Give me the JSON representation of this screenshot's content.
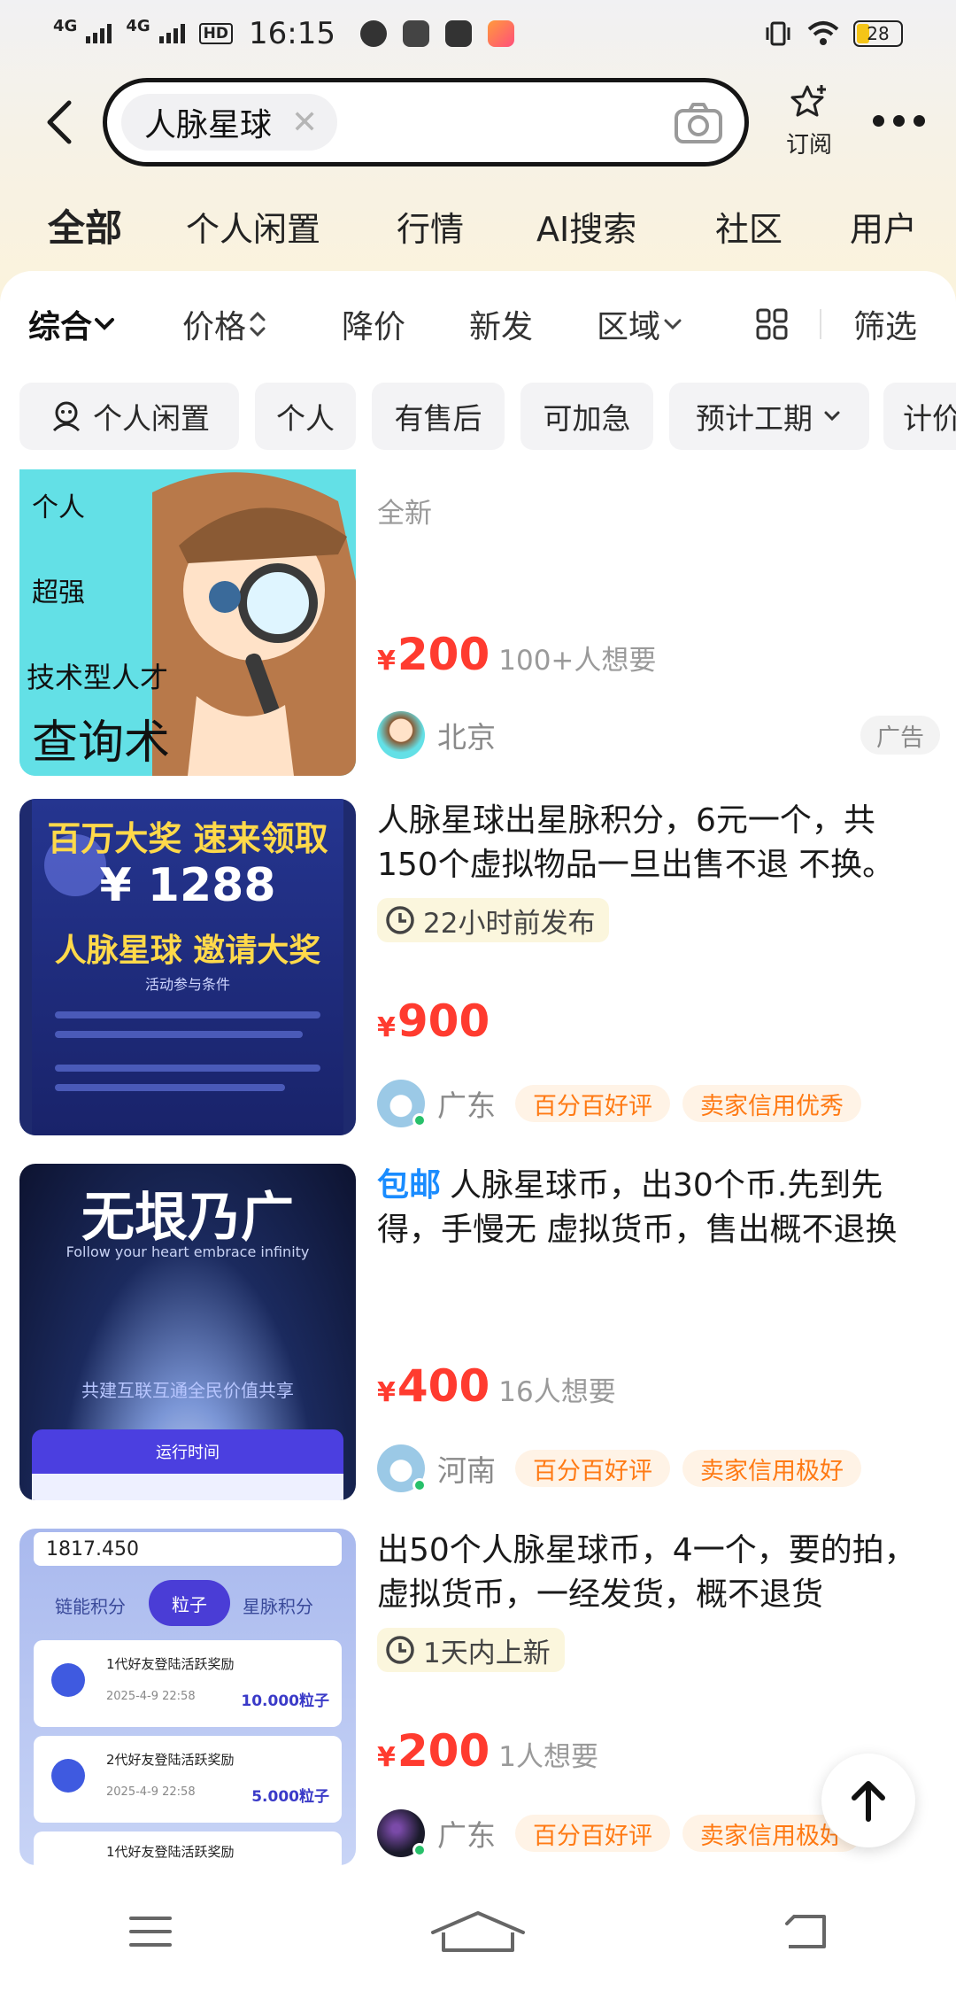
{
  "status_bar": {
    "network_1": "4G",
    "network_2": "4G",
    "hd": "HD",
    "time": "16:15",
    "battery": "28"
  },
  "search": {
    "query": "人脉星球",
    "subscribe_label": "订阅"
  },
  "category_tabs": [
    {
      "label": "全部",
      "active": true
    },
    {
      "label": "个人闲置"
    },
    {
      "label": "行情"
    },
    {
      "label": "AI搜索"
    },
    {
      "label": "社区"
    },
    {
      "label": "用户"
    }
  ],
  "sort_bar": {
    "comprehensive": "综合",
    "price": "价格",
    "price_drop": "降价",
    "new": "新发",
    "region": "区域",
    "filter": "筛选"
  },
  "filter_chips": [
    {
      "label": "个人闲置"
    },
    {
      "label": "个人"
    },
    {
      "label": "有售后"
    },
    {
      "label": "可加急"
    },
    {
      "label": "预计工期"
    },
    {
      "label": "计价"
    }
  ],
  "items": [
    {
      "thumb_text": [
        "个人",
        "超强",
        "技术型人才",
        "查询术"
      ],
      "condition": "全新",
      "price": "200",
      "currency": "¥",
      "wants": "100+人想要",
      "region": "北京",
      "ad_label": "广告"
    },
    {
      "thumb_text": [
        "百万大奖 速来领取",
        "¥ 1288",
        "人脉星球 邀请大奖",
        "活动参与条件"
      ],
      "title": "人脉星球出星脉积分，6元一个，共150个虚拟物品一旦出售不退 不换。",
      "time_label": "22小时前发布",
      "price": "900",
      "currency": "¥",
      "region": "广东",
      "badges": [
        "百分百好评",
        "卖家信用优秀"
      ]
    },
    {
      "thumb_text": [
        "无垠乃广",
        "Follow your heart embrace infinity",
        "共建互联互通全民价值共享",
        "运行时间"
      ],
      "ship_tag": "包邮",
      "title": "人脉星球币，出30个币.先到先得，手慢无 虚拟货币，售出概不退换",
      "price": "400",
      "currency": "¥",
      "wants": "16人想要",
      "region": "河南",
      "badges": [
        "百分百好评",
        "卖家信用极好"
      ]
    },
    {
      "thumb_text": [
        "1817.450",
        "链能积分",
        "粒子",
        "星脉积分",
        "1代好友登陆活跃奖励",
        "2025-4-9 22:58",
        "10.000粒子",
        "2代好友登陆活跃奖励",
        "2025-4-9 22:58",
        "5.000粒子",
        "1代好友登陆活跃奖励"
      ],
      "title": "出50个人脉星球币，4一个，要的拍， 虚拟货币，一经发货，概不退货",
      "time_label": "1天内上新",
      "price": "200",
      "currency": "¥",
      "wants": "1人想要",
      "region": "广东",
      "badges": [
        "百分百好评",
        "卖家信用极好"
      ]
    }
  ]
}
